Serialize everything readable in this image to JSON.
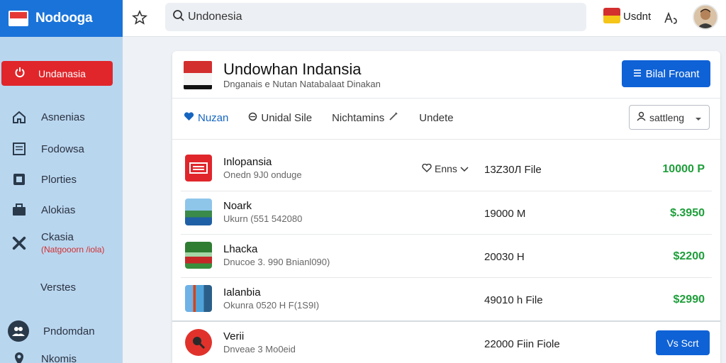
{
  "brand": {
    "name": "Nodooga"
  },
  "sidebar": {
    "primary_label": "Undanasia",
    "items": [
      {
        "label": "Asnenias",
        "icon": "home-icon"
      },
      {
        "label": "Fodowsa",
        "icon": "document-icon"
      },
      {
        "label": "Plorties",
        "icon": "square-icon"
      },
      {
        "label": "Alokias",
        "icon": "briefcase-icon"
      },
      {
        "label": "Ckasia",
        "sublabel": "(Natgooorn /iola)",
        "icon": "tools-icon"
      },
      {
        "label": "Verstes"
      },
      {
        "label": "Pndomdan",
        "icon": "users-icon"
      },
      {
        "label": "Nkomis",
        "icon": "location-pin-icon"
      }
    ]
  },
  "topbar": {
    "search_value": "Undonesia",
    "user_name": "Usdnt"
  },
  "header": {
    "title": "Undowhan Indansia",
    "subtitle": "Dnganais e Nutan  Natabalaat Dinakan",
    "action_label": "Bilal Froant"
  },
  "tabs": [
    {
      "label": "Nuzan",
      "active": true
    },
    {
      "label": "Unidal Sile"
    },
    {
      "label": "Nichtamins"
    },
    {
      "label": "Undete"
    }
  ],
  "sort": {
    "label": "sattleng"
  },
  "rows": [
    {
      "name": "Inlopansia",
      "meta": "Onedn 9J0 onduge",
      "filter": "Enns",
      "size": "13Z30Л File",
      "price": "10000 P"
    },
    {
      "name": "Noark",
      "meta": "Ukurn  (551 542080",
      "size": "19000 M",
      "price": "$.3950"
    },
    {
      "name": "Lhacka",
      "meta": "Dnucoe 3. 990 Bnianl090)",
      "size": "20030 H",
      "price": "$2200"
    },
    {
      "name": "Ialanbia",
      "meta": "Okunra 0520 H F(1S9I)",
      "size": "49010 h File",
      "price": "$2990"
    },
    {
      "name": "Verii",
      "meta": "Dnveae 3 Mo0eid",
      "size": "22000 Fiin Fiole",
      "button_label": "Vs Scrt"
    }
  ]
}
